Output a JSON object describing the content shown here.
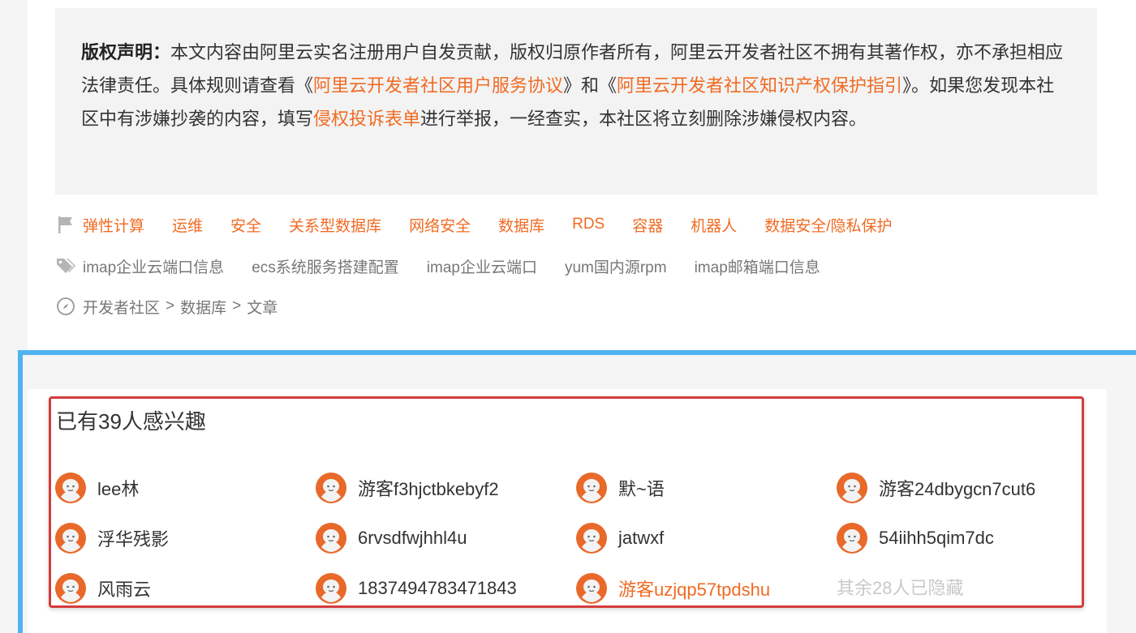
{
  "copyright": {
    "label": "版权声明：",
    "text1": "本文内容由阿里云实名注册用户自发贡献，版权归原作者所有，阿里云开发者社区不拥有其著作权，亦不承担相应法律责任。具体规则请查看《",
    "link1": "阿里云开发者社区用户服务协议",
    "text2": "》和《",
    "link2": "阿里云开发者社区知识产权保护指引",
    "text3": "》。如果您发现本社区中有涉嫌抄袭的内容，填写",
    "link3": "侵权投诉表单",
    "text4": "进行举报，一经查实，本社区将立刻删除涉嫌侵权内容。"
  },
  "categories": [
    "弹性计算",
    "运维",
    "安全",
    "关系型数据库",
    "网络安全",
    "数据库",
    "RDS",
    "容器",
    "机器人",
    "数据安全/隐私保护"
  ],
  "tags": [
    "imap企业云端口信息",
    "ecs系统服务搭建配置",
    "imap企业云端口",
    "yum国内源rpm",
    "imap邮箱端口信息"
  ],
  "breadcrumb": [
    "开发者社区",
    "数据库",
    "文章"
  ],
  "breadcrumb_sep": ">",
  "interest": {
    "title": "已有39人感兴趣",
    "users": [
      {
        "name": "lee林"
      },
      {
        "name": "游客f3hjctbkebyf2"
      },
      {
        "name": "默~语"
      },
      {
        "name": "游客24dbygcn7cut6"
      },
      {
        "name": "浮华残影"
      },
      {
        "name": "6rvsdfwjhhl4u"
      },
      {
        "name": "jatwxf"
      },
      {
        "name": "54iihh5qim7dc"
      },
      {
        "name": "风雨云"
      },
      {
        "name": "1837494783471843"
      },
      {
        "name": "游客uzjqp57tpdshu",
        "highlight": true
      }
    ],
    "hidden_note": "其余28人已隐藏"
  },
  "icons": {
    "category": "flag-icon",
    "tag": "tags-icon",
    "breadcrumb": "compass-icon",
    "avatar": "default-avatar-icon"
  },
  "colors": {
    "link": "#f06b23",
    "frame_blue": "#4fb3f0",
    "frame_red": "#d43c3c"
  }
}
